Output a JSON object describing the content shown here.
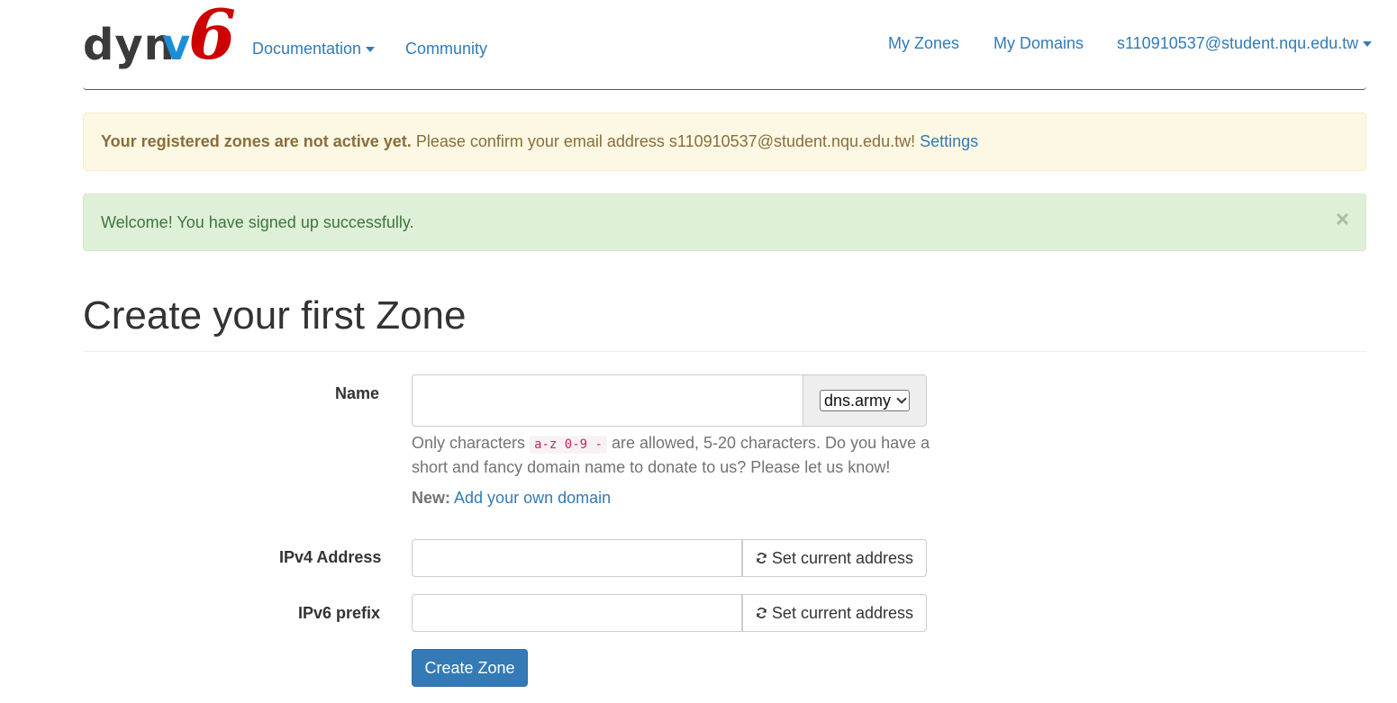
{
  "brand": {
    "part1": "dyn",
    "part2": "v",
    "part3": "6"
  },
  "nav": {
    "documentation": "Documentation",
    "community": "Community",
    "my_zones": "My Zones",
    "my_domains": "My Domains",
    "user_email": "s110910537@student.nqu.edu.tw"
  },
  "alerts": {
    "warning": {
      "bold": "Your registered zones are not active yet.",
      "text": "Please confirm your email address s110910537@student.nqu.edu.tw!",
      "link": "Settings"
    },
    "success": {
      "text": "Welcome! You have signed up successfully.",
      "close": "×"
    }
  },
  "page": {
    "title": "Create your first Zone"
  },
  "form": {
    "name": {
      "label": "Name",
      "value": "",
      "domain_selected": "dns.army",
      "help_before": "Only characters",
      "help_code": "a-z 0-9 -",
      "help_after": "are allowed, 5-20 characters. Do you have a short and fancy domain name to donate to us? Please let us know!",
      "new_label": "New:",
      "new_link": "Add your own domain"
    },
    "ipv4": {
      "label": "IPv4 Address",
      "value": "",
      "button": "Set current address"
    },
    "ipv6": {
      "label": "IPv6 prefix",
      "value": "",
      "button": "Set current address"
    },
    "submit": "Create Zone"
  },
  "icons": {
    "caret": "caret-down-icon",
    "refresh": "refresh-icon",
    "close": "close-icon"
  },
  "colors": {
    "link": "#337ab7",
    "primary": "#337ab7",
    "logo_dark": "#3a3a3a",
    "logo_blue": "#1a8fd8",
    "logo_red": "#cc0000"
  }
}
